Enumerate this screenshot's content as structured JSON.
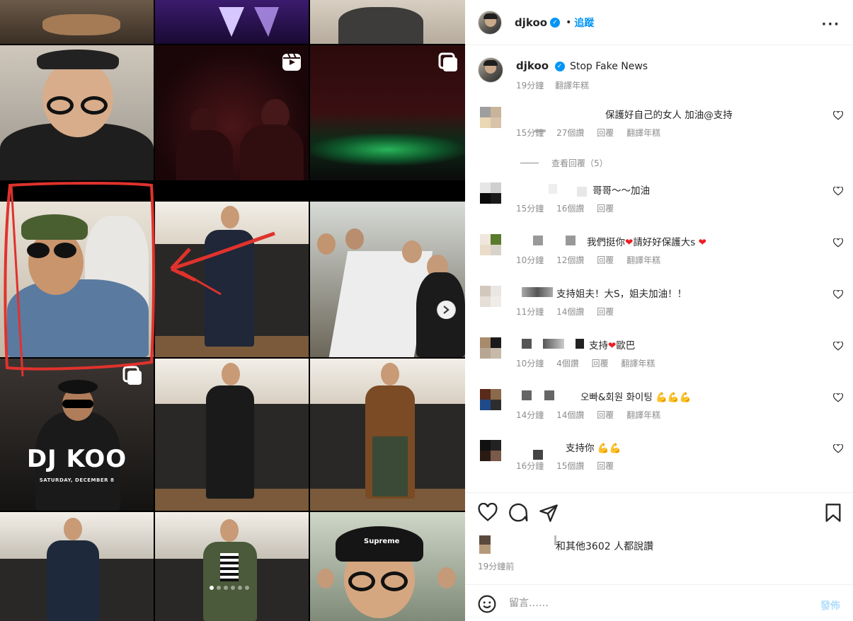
{
  "header": {
    "username": "djkoo",
    "separator": "•",
    "follow_label": "追蹤",
    "more_label": "···"
  },
  "caption": {
    "username": "djkoo",
    "text": "Stop Fake News",
    "time": "19分鐘",
    "translate": "翻譯年糕"
  },
  "comments": [
    {
      "text": "保護好自己的女人 加油@支持",
      "time": "15分鐘",
      "likes": "27個讚",
      "reply": "回覆",
      "translate": "翻譯年糕"
    },
    {
      "text": "哥哥～～加油",
      "time": "15分鐘",
      "likes": "16個讚",
      "reply": "回覆"
    },
    {
      "text_a": "我們挺你",
      "text_b": "請好好保護大s",
      "time": "10分鐘",
      "likes": "12個讚",
      "reply": "回覆",
      "translate": "翻譯年糕"
    },
    {
      "text": "支持姐夫！大S，姐夫加油！！",
      "time": "11分鐘",
      "likes": "14個讚",
      "reply": "回覆"
    },
    {
      "text_a": "支持",
      "text_b": "歐巴",
      "time": "10分鐘",
      "likes": "4個讚",
      "reply": "回覆",
      "translate": "翻譯年糕"
    },
    {
      "text": "오빠&회원 화이팅",
      "time": "14分鐘",
      "likes": "14個讚",
      "reply": "回覆",
      "translate": "翻譯年糕"
    },
    {
      "text": "支持你",
      "time": "16分鐘",
      "likes": "15個讚",
      "reply": "回覆"
    }
  ],
  "view_replies": "查看回覆（5）",
  "likes_text": "和其他3602 人都說讚",
  "post_time": "19分鐘前",
  "add_comment": {
    "placeholder": "留言……",
    "post_label": "發佈"
  },
  "media": {
    "poster_title": "DJ KOO",
    "poster_date": "SATURDAY, DECEMBER 8",
    "cap_text": "Supreme",
    "carousel_count": 6,
    "carousel_active": 0
  },
  "colors": {
    "accent": "#0095f6",
    "heart": "#ed1c24",
    "annotation": "#e0322d"
  }
}
